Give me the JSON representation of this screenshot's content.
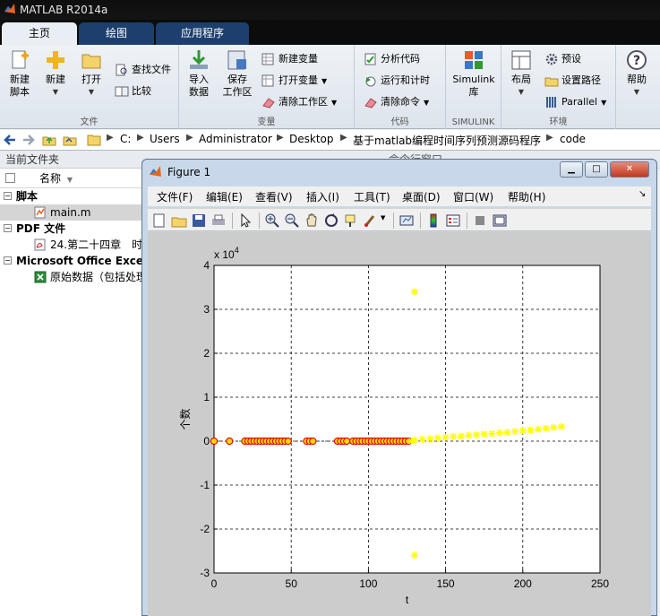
{
  "window": {
    "title": "MATLAB R2014a"
  },
  "ribbon_tabs": [
    "主页",
    "绘图",
    "应用程序"
  ],
  "ribbon": {
    "file": {
      "title": "文件",
      "new_script": "新建\n脚本",
      "new": "新建",
      "open": "打开",
      "find_files": "查找文件",
      "compare": "比较"
    },
    "variable": {
      "title": "变量",
      "import": "导入\n数据",
      "save_ws": "保存\n工作区",
      "new_var": "新建变量",
      "open_var": "打开变量",
      "clear_ws": "清除工作区"
    },
    "code": {
      "title": "代码",
      "analyze": "分析代码",
      "run_time": "运行和计时",
      "clear_cmd": "清除命令"
    },
    "simulink": {
      "title": "SIMULINK",
      "library": "Simulink\n库"
    },
    "env": {
      "title": "环境",
      "layout": "布局",
      "prefs": "预设",
      "set_path": "设置路径",
      "parallel": "Parallel"
    },
    "help": {
      "label": "帮助"
    }
  },
  "address": {
    "crumbs": [
      "C:",
      "Users",
      "Administrator",
      "Desktop",
      "基于matlab编程时间序列预测源码程序",
      "code"
    ]
  },
  "left_panel": {
    "title": "当前文件夹",
    "column": "名称",
    "sections": [
      {
        "label": "脚本",
        "files": [
          "main.m"
        ]
      },
      {
        "label": "PDF 文件",
        "files": [
          "24.第二十四章　时"
        ]
      },
      {
        "label": "Microsoft Office Excel",
        "files": [
          "原始数据（包括处理"
        ]
      }
    ]
  },
  "command_window": {
    "title": "命令行窗口"
  },
  "figure": {
    "title": "Figure 1",
    "menu": [
      "文件(F)",
      "编辑(E)",
      "查看(V)",
      "插入(I)",
      "工具(T)",
      "桌面(D)",
      "窗口(W)",
      "帮助(H)"
    ]
  },
  "colors": {
    "marker_red": "#dd0000",
    "marker_fill": "#ffd700",
    "forecast": "#ffff00",
    "grid": "#000000"
  },
  "chart_data": {
    "type": "scatter",
    "title": "",
    "xlabel": "t",
    "ylabel": "个数",
    "y_exponent": "x 10^4",
    "y_exponent_base": "x 10",
    "y_exponent_power": "4",
    "xlim": [
      0,
      250
    ],
    "ylim": [
      -3,
      4
    ],
    "xticks": [
      "0",
      "50",
      "100",
      "150",
      "200",
      "250"
    ],
    "yticks": [
      "-3",
      "-2",
      "-1",
      "0",
      "1",
      "2",
      "3",
      "4"
    ],
    "grid": true,
    "series": [
      {
        "marker": "circle",
        "x": [
          0,
          10,
          20,
          22,
          24,
          26,
          28,
          30,
          32,
          34,
          36,
          38,
          40,
          42,
          44,
          46,
          48,
          60,
          62,
          64,
          80,
          82,
          84,
          86,
          90,
          92,
          94,
          96,
          98,
          100,
          102,
          104,
          106,
          108,
          110,
          112,
          114,
          116,
          118,
          120,
          122,
          124,
          126
        ],
        "y": [
          0,
          0,
          0,
          0,
          0,
          0,
          0,
          0,
          0,
          0,
          0,
          0,
          0,
          0,
          0,
          0,
          0,
          0,
          0,
          0,
          0,
          0,
          0,
          0,
          0,
          0,
          0,
          0,
          0,
          0,
          0,
          0,
          0,
          0,
          0,
          0,
          0,
          0,
          0,
          0,
          0,
          0,
          0
        ]
      },
      {
        "marker": "star",
        "x": [
          128,
          130,
          135,
          140,
          145,
          150,
          155,
          160,
          165,
          170,
          175,
          180,
          185,
          190,
          195,
          200,
          205,
          210,
          215,
          220,
          225,
          130,
          130
        ],
        "y": [
          0,
          0.02,
          0.04,
          0.05,
          0.07,
          0.09,
          0.1,
          0.11,
          0.13,
          0.14,
          0.16,
          0.17,
          0.19,
          0.2,
          0.22,
          0.24,
          0.25,
          0.27,
          0.29,
          0.31,
          0.33,
          3.4,
          -2.6
        ]
      }
    ]
  }
}
